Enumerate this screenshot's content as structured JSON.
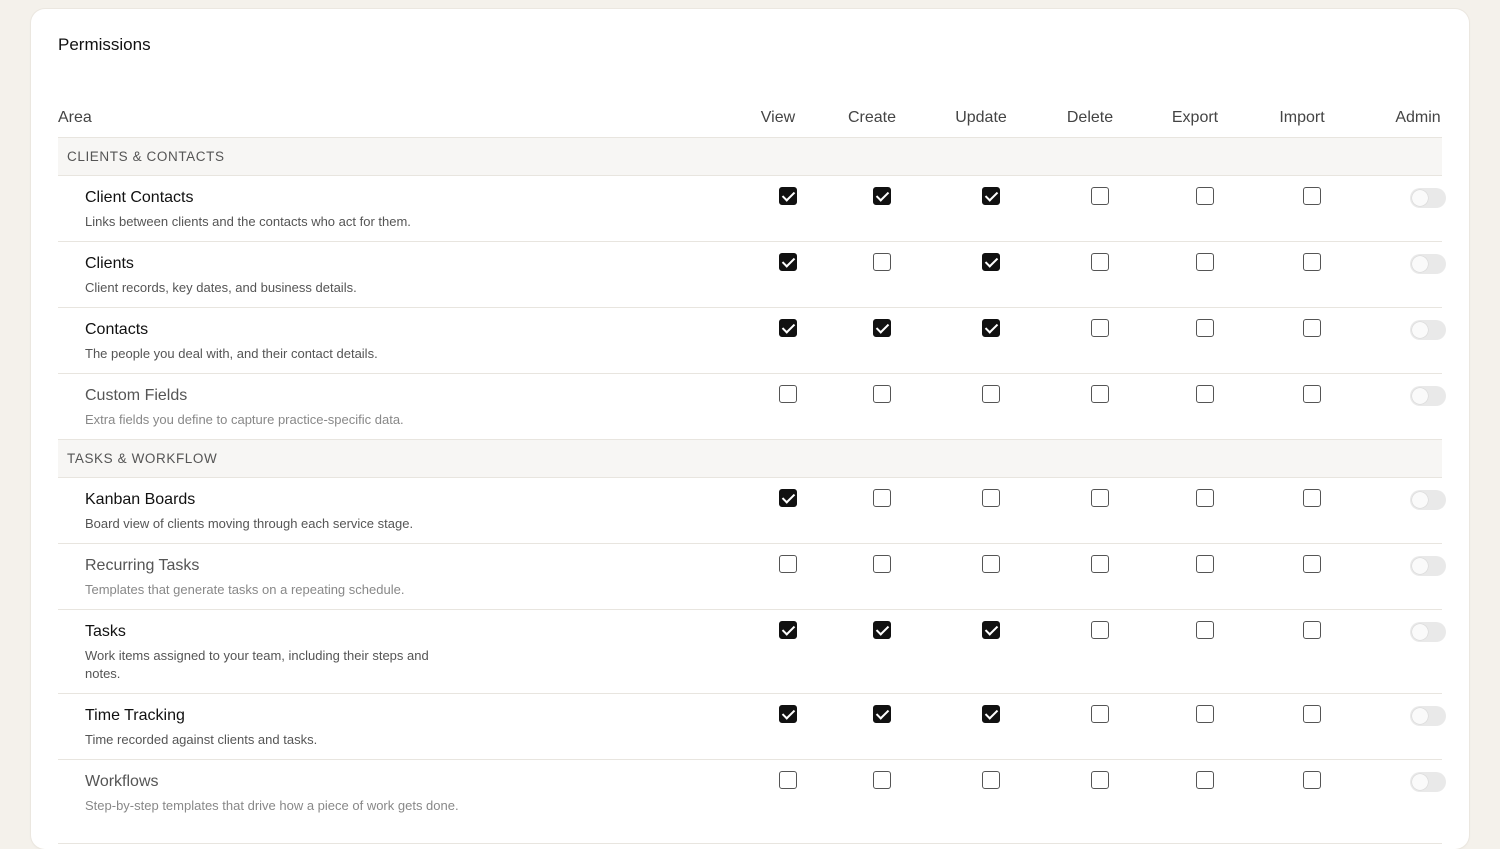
{
  "title": "Permissions",
  "columns": {
    "area": "Area",
    "view": "View",
    "create": "Create",
    "update": "Update",
    "delete": "Delete",
    "export": "Export",
    "import": "Import",
    "admin": "Admin"
  },
  "sections": [
    {
      "label": "CLIENTS & CONTACTS",
      "rows": [
        {
          "name": "Client Contacts",
          "desc": "Links between clients and the contacts who act for them.",
          "perms": [
            true,
            true,
            true,
            false,
            false,
            false
          ],
          "admin": false
        },
        {
          "name": "Clients",
          "desc": "Client records, key dates, and business details.",
          "perms": [
            true,
            false,
            true,
            false,
            false,
            false
          ],
          "admin": false
        },
        {
          "name": "Contacts",
          "desc": "The people you deal with, and their contact details.",
          "perms": [
            true,
            true,
            true,
            false,
            false,
            false
          ],
          "admin": false
        },
        {
          "name": "Custom Fields",
          "desc": "Extra fields you define to capture practice-specific data.",
          "perms": [
            false,
            false,
            false,
            false,
            false,
            false
          ],
          "admin": false
        }
      ]
    },
    {
      "label": "TASKS & WORKFLOW",
      "rows": [
        {
          "name": "Kanban Boards",
          "desc": "Board view of clients moving through each service stage.",
          "perms": [
            true,
            false,
            false,
            false,
            false,
            false
          ],
          "admin": false
        },
        {
          "name": "Recurring Tasks",
          "desc": "Templates that generate tasks on a repeating schedule.",
          "perms": [
            false,
            false,
            false,
            false,
            false,
            false
          ],
          "admin": false
        },
        {
          "name": "Tasks",
          "desc": "Work items assigned to your team, including their steps and notes.",
          "perms": [
            true,
            true,
            true,
            false,
            false,
            false
          ],
          "admin": false
        },
        {
          "name": "Time Tracking",
          "desc": "Time recorded against clients and tasks.",
          "perms": [
            true,
            true,
            true,
            false,
            false,
            false
          ],
          "admin": false
        },
        {
          "name": "Workflows",
          "desc": "Step-by-step templates that drive how a piece of work gets done.",
          "perms": [
            false,
            false,
            false,
            false,
            false,
            false
          ],
          "admin": false
        }
      ]
    }
  ]
}
